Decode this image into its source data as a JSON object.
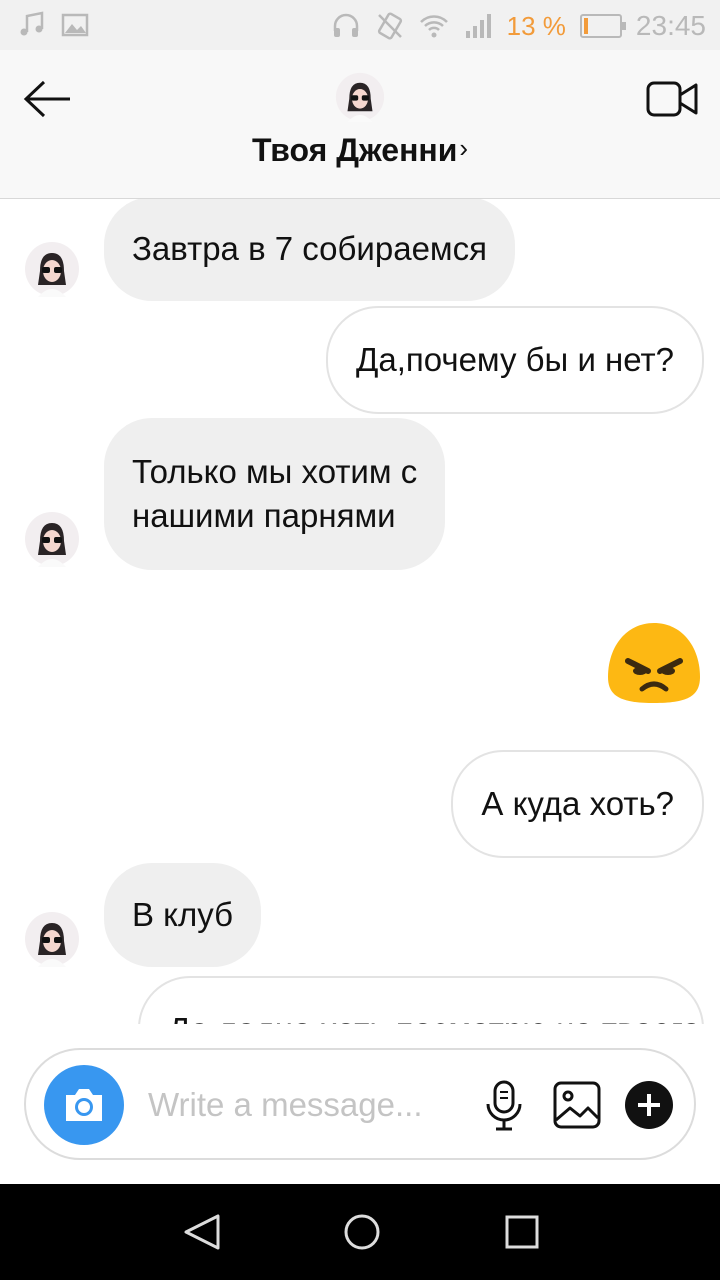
{
  "status_bar": {
    "time": "23:45",
    "battery_percent_label": "13 %",
    "battery_level": 0.13,
    "icons": [
      "music-icon",
      "image-icon",
      "headset-icon",
      "silent-icon",
      "wifi-icon",
      "signal-icon",
      "battery-icon"
    ]
  },
  "header": {
    "title": "Твоя Дженни",
    "chevron": "›",
    "icons": [
      "back-arrow-icon",
      "video-call-icon"
    ]
  },
  "messages": [
    {
      "side": "in",
      "text": "Завтра в 7 собираемся"
    },
    {
      "side": "out",
      "text": "Да,почему бы и нет?"
    },
    {
      "side": "in",
      "text_lines": [
        "Только мы хотим с",
        "нашими парнями"
      ]
    },
    {
      "side": "out",
      "emoji": "angry-face-icon"
    },
    {
      "side": "out",
      "text": "А куда хоть?"
    },
    {
      "side": "in",
      "text": "В клуб"
    },
    {
      "side": "out",
      "text": "Да ладно хоть посмотрю на твоего"
    }
  ],
  "composer": {
    "placeholder": "Write a message...",
    "value": "",
    "accent": "#3897f0",
    "icons": [
      "camera-icon",
      "microphone-icon",
      "gallery-icon",
      "plus-icon"
    ]
  },
  "nav_bar": {
    "icons": [
      "nav-back-icon",
      "nav-home-icon",
      "nav-recents-icon"
    ]
  }
}
